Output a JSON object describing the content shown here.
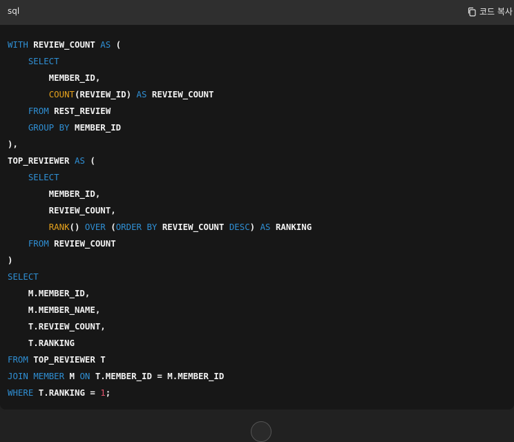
{
  "code_block": {
    "language": "sql",
    "copy_label": "코드 복사",
    "lines": [
      [
        {
          "t": "WITH",
          "k": "kw"
        },
        {
          "t": " REVIEW_COUNT "
        },
        {
          "t": "AS",
          "k": "kw"
        },
        {
          "t": " ("
        }
      ],
      [
        {
          "t": "    "
        },
        {
          "t": "SELECT",
          "k": "kw"
        }
      ],
      [
        {
          "t": "        MEMBER_ID,"
        }
      ],
      [
        {
          "t": "        "
        },
        {
          "t": "COUNT",
          "k": "fn"
        },
        {
          "t": "(REVIEW_ID) "
        },
        {
          "t": "AS",
          "k": "kw"
        },
        {
          "t": " REVIEW_COUNT"
        }
      ],
      [
        {
          "t": "    "
        },
        {
          "t": "FROM",
          "k": "kw"
        },
        {
          "t": " REST_REVIEW"
        }
      ],
      [
        {
          "t": "    "
        },
        {
          "t": "GROUP BY",
          "k": "kw"
        },
        {
          "t": " MEMBER_ID"
        }
      ],
      [
        {
          "t": "),"
        }
      ],
      [
        {
          "t": "TOP_REVIEWER "
        },
        {
          "t": "AS",
          "k": "kw"
        },
        {
          "t": " ("
        }
      ],
      [
        {
          "t": "    "
        },
        {
          "t": "SELECT",
          "k": "kw"
        }
      ],
      [
        {
          "t": "        MEMBER_ID,"
        }
      ],
      [
        {
          "t": "        REVIEW_COUNT,"
        }
      ],
      [
        {
          "t": "        "
        },
        {
          "t": "RANK",
          "k": "fn"
        },
        {
          "t": "() "
        },
        {
          "t": "OVER",
          "k": "kw"
        },
        {
          "t": " ("
        },
        {
          "t": "ORDER BY",
          "k": "kw"
        },
        {
          "t": " REVIEW_COUNT "
        },
        {
          "t": "DESC",
          "k": "kw"
        },
        {
          "t": ") "
        },
        {
          "t": "AS",
          "k": "kw"
        },
        {
          "t": " RANKING"
        }
      ],
      [
        {
          "t": "    "
        },
        {
          "t": "FROM",
          "k": "kw"
        },
        {
          "t": " REVIEW_COUNT"
        }
      ],
      [
        {
          "t": ")"
        }
      ],
      [
        {
          "t": "SELECT",
          "k": "kw"
        }
      ],
      [
        {
          "t": "    M.MEMBER_ID,"
        }
      ],
      [
        {
          "t": "    M.MEMBER_NAME,"
        }
      ],
      [
        {
          "t": "    T.REVIEW_COUNT,"
        }
      ],
      [
        {
          "t": "    T.RANKING"
        }
      ],
      [
        {
          "t": "FROM",
          "k": "kw"
        },
        {
          "t": " TOP_REVIEWER T"
        }
      ],
      [
        {
          "t": "JOIN",
          "k": "kw"
        },
        {
          "t": " "
        },
        {
          "t": "MEMBER",
          "k": "kw"
        },
        {
          "t": " M "
        },
        {
          "t": "ON",
          "k": "kw"
        },
        {
          "t": " T.MEMBER_ID = M.MEMBER_ID"
        }
      ],
      [
        {
          "t": "WHERE",
          "k": "kw"
        },
        {
          "t": " T.RANKING = "
        },
        {
          "t": "1",
          "k": "num"
        },
        {
          "t": ";"
        }
      ]
    ]
  },
  "colors": {
    "keyword": "#2f8fd4",
    "function": "#e5a11c",
    "number": "#e3536c",
    "identifier": "#f2f2f2"
  },
  "icons": {
    "copy": "copy-icon",
    "scroll": "scroll-down-button"
  }
}
